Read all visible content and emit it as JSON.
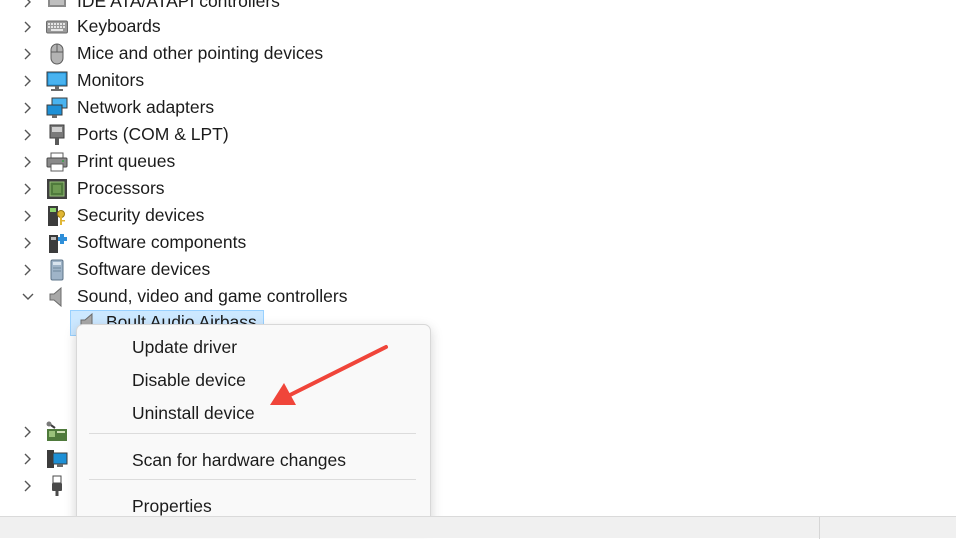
{
  "tree": {
    "items": [
      {
        "label": "IDE ATA/ATAPI controllers",
        "icon": "ide-controller-icon"
      },
      {
        "label": "Keyboards",
        "icon": "keyboard-icon"
      },
      {
        "label": "Mice and other pointing devices",
        "icon": "mouse-icon"
      },
      {
        "label": "Monitors",
        "icon": "monitor-icon"
      },
      {
        "label": "Network adapters",
        "icon": "network-adapter-icon"
      },
      {
        "label": "Ports (COM & LPT)",
        "icon": "port-icon"
      },
      {
        "label": "Print queues",
        "icon": "printer-icon"
      },
      {
        "label": "Processors",
        "icon": "processor-icon"
      },
      {
        "label": "Security devices",
        "icon": "security-device-icon"
      },
      {
        "label": "Software components",
        "icon": "software-component-icon"
      },
      {
        "label": "Software devices",
        "icon": "software-device-icon"
      },
      {
        "label": "Sound, video and game controllers",
        "icon": "speaker-icon",
        "expanded": true
      }
    ],
    "child": {
      "label": "Boult Audio Airbass",
      "icon": "speaker-icon"
    },
    "below_items": [
      {
        "icon": "storage-controller-icon"
      },
      {
        "icon": "system-devices-icon"
      },
      {
        "icon": "usb-controller-icon"
      }
    ]
  },
  "context_menu": {
    "items": [
      "Update driver",
      "Disable device",
      "Uninstall device",
      "Scan for hardware changes",
      "Properties"
    ]
  },
  "colors": {
    "selection": "#cce8ff",
    "arrow": "#f0453a"
  }
}
